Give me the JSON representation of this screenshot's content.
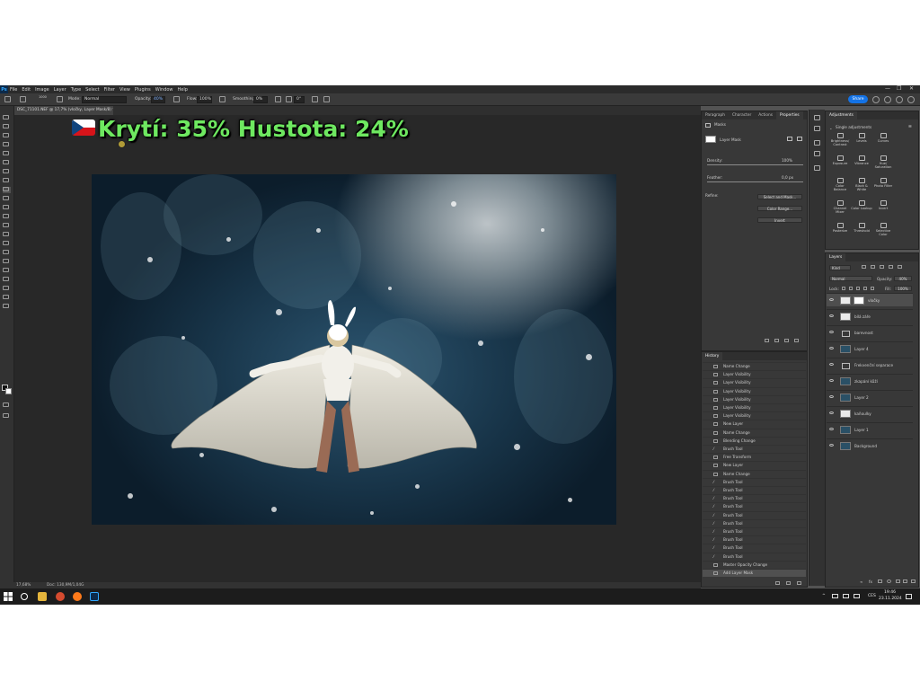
{
  "app": {
    "logo": "Ps",
    "menu": [
      "File",
      "Edit",
      "Image",
      "Layer",
      "Type",
      "Select",
      "Filter",
      "View",
      "Plugins",
      "Window",
      "Help"
    ]
  },
  "options_bar": {
    "brush_size": "1000",
    "mode_label": "Mode:",
    "mode_value": "Normal",
    "opacity_label": "Opacity:",
    "opacity_value": "40%",
    "flow_label": "Flow:",
    "flow_value": "100%",
    "smoothing_label": "Smoothing:",
    "smoothing_value": "0%",
    "angle_value": "0°",
    "share_label": "Share"
  },
  "document": {
    "tab_title": "DSC_71101.NEF @ 17,7% (vločky, Layer Mask/8) *",
    "zoom": "17,68%",
    "doc_info": "Doc: 130,9M/1,04G"
  },
  "overlay": {
    "caption": "Krytí: 35%   Hustota: 24%",
    "flag_icon": "czech-flag-icon"
  },
  "properties_panel": {
    "tabs": [
      "Paragraph",
      "Character",
      "Actions",
      "Properties"
    ],
    "active_tab": "Properties",
    "section_label": "Masks",
    "mask_label": "Layer Mask",
    "density_label": "Density:",
    "density_value": "100%",
    "feather_label": "Feather:",
    "feather_value": "0,0 px",
    "refine_label": "Refine:",
    "buttons": [
      "Select and Mask...",
      "Color Range...",
      "Invert"
    ]
  },
  "adjustments_panel": {
    "title": "Adjustments",
    "section": "Single adjustments",
    "items": [
      "Brightness/ Contrast",
      "Levels",
      "Curves",
      "Exposure",
      "Vibrance",
      "Hue/ Saturation",
      "Color Balance",
      "Black & White",
      "Photo Filter",
      "Channel Mixer",
      "Color Lookup",
      "Invert",
      "Posterize",
      "Threshold",
      "Selective Color"
    ]
  },
  "layers_panel": {
    "title": "Layers",
    "filter_kind": "Kind",
    "blend_mode": "Normal",
    "opacity_label": "Opacity:",
    "opacity_value": "40%",
    "lock_label": "Lock:",
    "fill_label": "Fill:",
    "fill_value": "100%",
    "layers": [
      {
        "name": "vločky",
        "type": "white",
        "mask": true,
        "active": true
      },
      {
        "name": "bílá záře",
        "type": "white",
        "mask": false,
        "active": false
      },
      {
        "name": "barevnost",
        "type": "folder",
        "mask": false,
        "active": false
      },
      {
        "name": "Layer 4",
        "type": "photo",
        "mask": false,
        "active": false
      },
      {
        "name": "Frekvenční separace",
        "type": "folder",
        "mask": false,
        "active": false
      },
      {
        "name": "zkapání kůží",
        "type": "photo",
        "mask": false,
        "active": false
      },
      {
        "name": "Layer 2",
        "type": "photo",
        "mask": false,
        "active": false
      },
      {
        "name": "kaňoulky",
        "type": "white",
        "mask": false,
        "active": false
      },
      {
        "name": "Layer 1",
        "type": "photo",
        "mask": false,
        "active": false
      },
      {
        "name": "Background",
        "type": "photo",
        "mask": false,
        "active": false
      }
    ]
  },
  "history_panel": {
    "title": "History",
    "items": [
      {
        "label": "Name Change",
        "icon": "layer-icon"
      },
      {
        "label": "Layer Visibility",
        "icon": "layer-icon"
      },
      {
        "label": "Layer Visibility",
        "icon": "layer-icon"
      },
      {
        "label": "Layer Visibility",
        "icon": "layer-icon"
      },
      {
        "label": "Layer Visibility",
        "icon": "layer-icon"
      },
      {
        "label": "Layer Visibility",
        "icon": "layer-icon"
      },
      {
        "label": "Layer Visibility",
        "icon": "layer-icon"
      },
      {
        "label": "New Layer",
        "icon": "layer-icon"
      },
      {
        "label": "Name Change",
        "icon": "layer-icon"
      },
      {
        "label": "Blending Change",
        "icon": "layer-icon"
      },
      {
        "label": "Brush Tool",
        "icon": "brush-icon"
      },
      {
        "label": "Free Transform",
        "icon": "layer-icon"
      },
      {
        "label": "New Layer",
        "icon": "layer-icon"
      },
      {
        "label": "Name Change",
        "icon": "layer-icon"
      },
      {
        "label": "Brush Tool",
        "icon": "brush-icon"
      },
      {
        "label": "Brush Tool",
        "icon": "brush-icon"
      },
      {
        "label": "Brush Tool",
        "icon": "brush-icon"
      },
      {
        "label": "Brush Tool",
        "icon": "brush-icon"
      },
      {
        "label": "Brush Tool",
        "icon": "brush-icon"
      },
      {
        "label": "Brush Tool",
        "icon": "brush-icon"
      },
      {
        "label": "Brush Tool",
        "icon": "brush-icon"
      },
      {
        "label": "Brush Tool",
        "icon": "brush-icon"
      },
      {
        "label": "Brush Tool",
        "icon": "brush-icon"
      },
      {
        "label": "Brush Tool",
        "icon": "brush-icon"
      },
      {
        "label": "Master Opacity Change",
        "icon": "layer-icon"
      },
      {
        "label": "Add Layer Mask",
        "icon": "layer-icon"
      }
    ]
  },
  "taskbar": {
    "language": "CES",
    "time": "19:46",
    "date": "23.11.2024"
  },
  "colors": {
    "accent": "#1473e6",
    "caption_green": "#6ee860"
  }
}
